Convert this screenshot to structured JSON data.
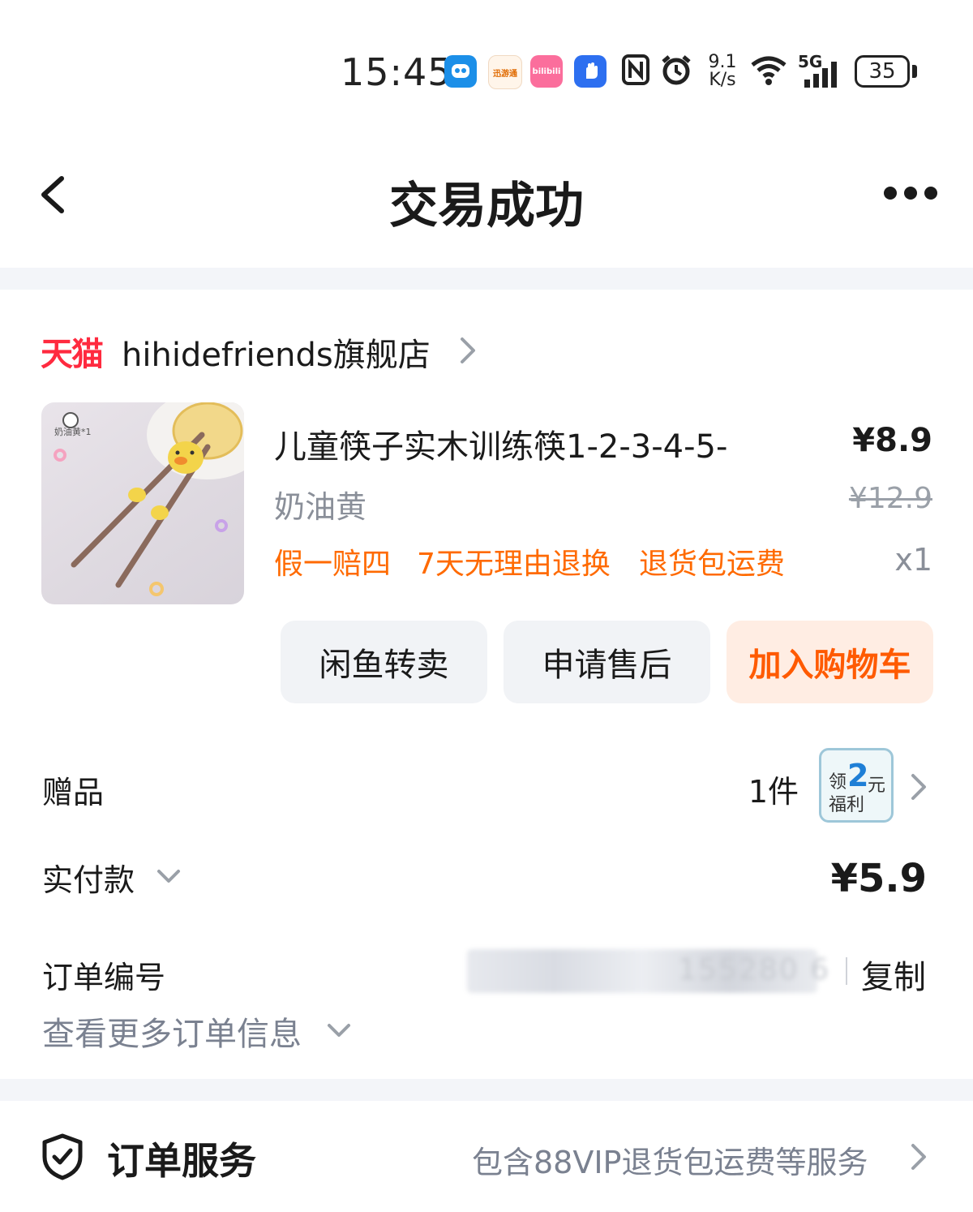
{
  "status_bar": {
    "time": "15:45",
    "network_speed_value": "9.1",
    "network_speed_unit": "K/s",
    "signal_type": "5G",
    "battery": "35",
    "app_icons": [
      "robot-app-icon",
      "xunyoutong-app-icon",
      "bilibili-app-icon",
      "hand-app-icon"
    ],
    "app_icon_labels": [
      "",
      "迅游通",
      "bilibili",
      ""
    ]
  },
  "header": {
    "title": "交易成功"
  },
  "shop": {
    "brand": "天猫",
    "name": "hihidefriends旗舰店"
  },
  "product": {
    "title": "儿童筷子实木训练筷1-2-3-4-5-",
    "variant": "奶油黄",
    "price": "¥8.9",
    "original_price": "¥12.9",
    "quantity": "x1",
    "image_label": "奶油黄*1",
    "tags": [
      "假一赔四",
      "7天无理由退换",
      "退货包运费"
    ]
  },
  "actions": {
    "resell_label": "闲鱼转卖",
    "after_sales_label": "申请售后",
    "add_cart_label": "加入购物车"
  },
  "gift": {
    "label": "赠品",
    "count": "1件",
    "thumb_line1": "领",
    "thumb_number": "2",
    "thumb_unit": "元",
    "thumb_line2": "福利"
  },
  "payment": {
    "label": "实付款",
    "amount": "¥5.9"
  },
  "order": {
    "number_label": "订单编号",
    "number_value": "155280 6",
    "copy_label": "复制",
    "more_info_label": "查看更多订单信息"
  },
  "service": {
    "title": "订单服务",
    "description": "包含88VIP退货包运费等服务"
  },
  "colors": {
    "accent_orange": "#ff6a00",
    "tmall_red": "#ff2a3f",
    "background_gray": "#f3f5f9"
  }
}
